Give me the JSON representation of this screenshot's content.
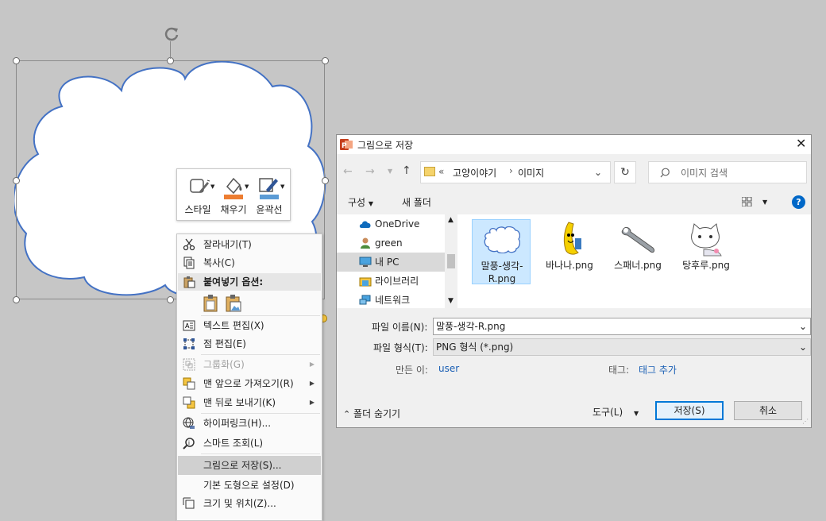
{
  "mini_toolbar": {
    "style": "스타일",
    "fill": "채우기",
    "outline": "윤곽선"
  },
  "context_menu": {
    "items": [
      {
        "label": "잘라내기(T)",
        "icon": "scissors-icon",
        "enabled": true
      },
      {
        "label": "복사(C)",
        "icon": "copy-icon",
        "enabled": true
      },
      {
        "label": "붙여넣기 옵션:",
        "icon": "paste-icon",
        "enabled": true,
        "header": true
      },
      {
        "label": "텍스트 편집(X)",
        "icon": "text-edit-icon",
        "enabled": true
      },
      {
        "label": "점 편집(E)",
        "icon": "edit-points-icon",
        "enabled": true
      },
      {
        "label": "그룹화(G)",
        "icon": "group-icon",
        "enabled": false,
        "submenu": true
      },
      {
        "label": "맨 앞으로 가져오기(R)",
        "icon": "bring-front-icon",
        "enabled": true,
        "submenu": true
      },
      {
        "label": "맨 뒤로 보내기(K)",
        "icon": "send-back-icon",
        "enabled": true,
        "submenu": true
      },
      {
        "label": "하이퍼링크(H)...",
        "icon": "hyperlink-icon",
        "enabled": true
      },
      {
        "label": "스마트 조회(L)",
        "icon": "smart-lookup-icon",
        "enabled": true
      },
      {
        "label": "그림으로 저장(S)...",
        "icon": "",
        "enabled": true,
        "highlighted": true
      },
      {
        "label": "기본 도형으로 설정(D)",
        "icon": "",
        "enabled": true
      },
      {
        "label": "크기 및 위치(Z)...",
        "icon": "size-position-icon",
        "enabled": true
      }
    ]
  },
  "dialog": {
    "title": "그림으로 저장",
    "address": {
      "prefix": "«",
      "parts": [
        "고양이야기",
        "이미지"
      ]
    },
    "search_placeholder": "이미지 검색",
    "toolbar": {
      "organize": "구성",
      "new_folder": "새 폴더"
    },
    "nav": [
      "OneDrive",
      "green",
      "내 PC",
      "라이브러리",
      "네트워크"
    ],
    "files": [
      "말풍-생각-R.png",
      "바나나.png",
      "스패너.png",
      "탕후루.png"
    ],
    "filename_label": "파일 이름(N):",
    "filename_value": "말풍-생각-R.png",
    "filetype_label": "파일 형식(T):",
    "filetype_value": "PNG 형식 (*.png)",
    "author_label": "만든 이:",
    "author_value": "user",
    "tags_label": "태그:",
    "tags_value": "태그 추가",
    "hide_folders": "폴더 숨기기",
    "tools": "도구(L)",
    "save": "저장(S)",
    "cancel": "취소"
  },
  "colors": {
    "accent": "#0078d7",
    "cloud_stroke": "#4472c4",
    "fill_swatch": "#ed7d31",
    "outline_swatch": "#5b9bd5"
  }
}
